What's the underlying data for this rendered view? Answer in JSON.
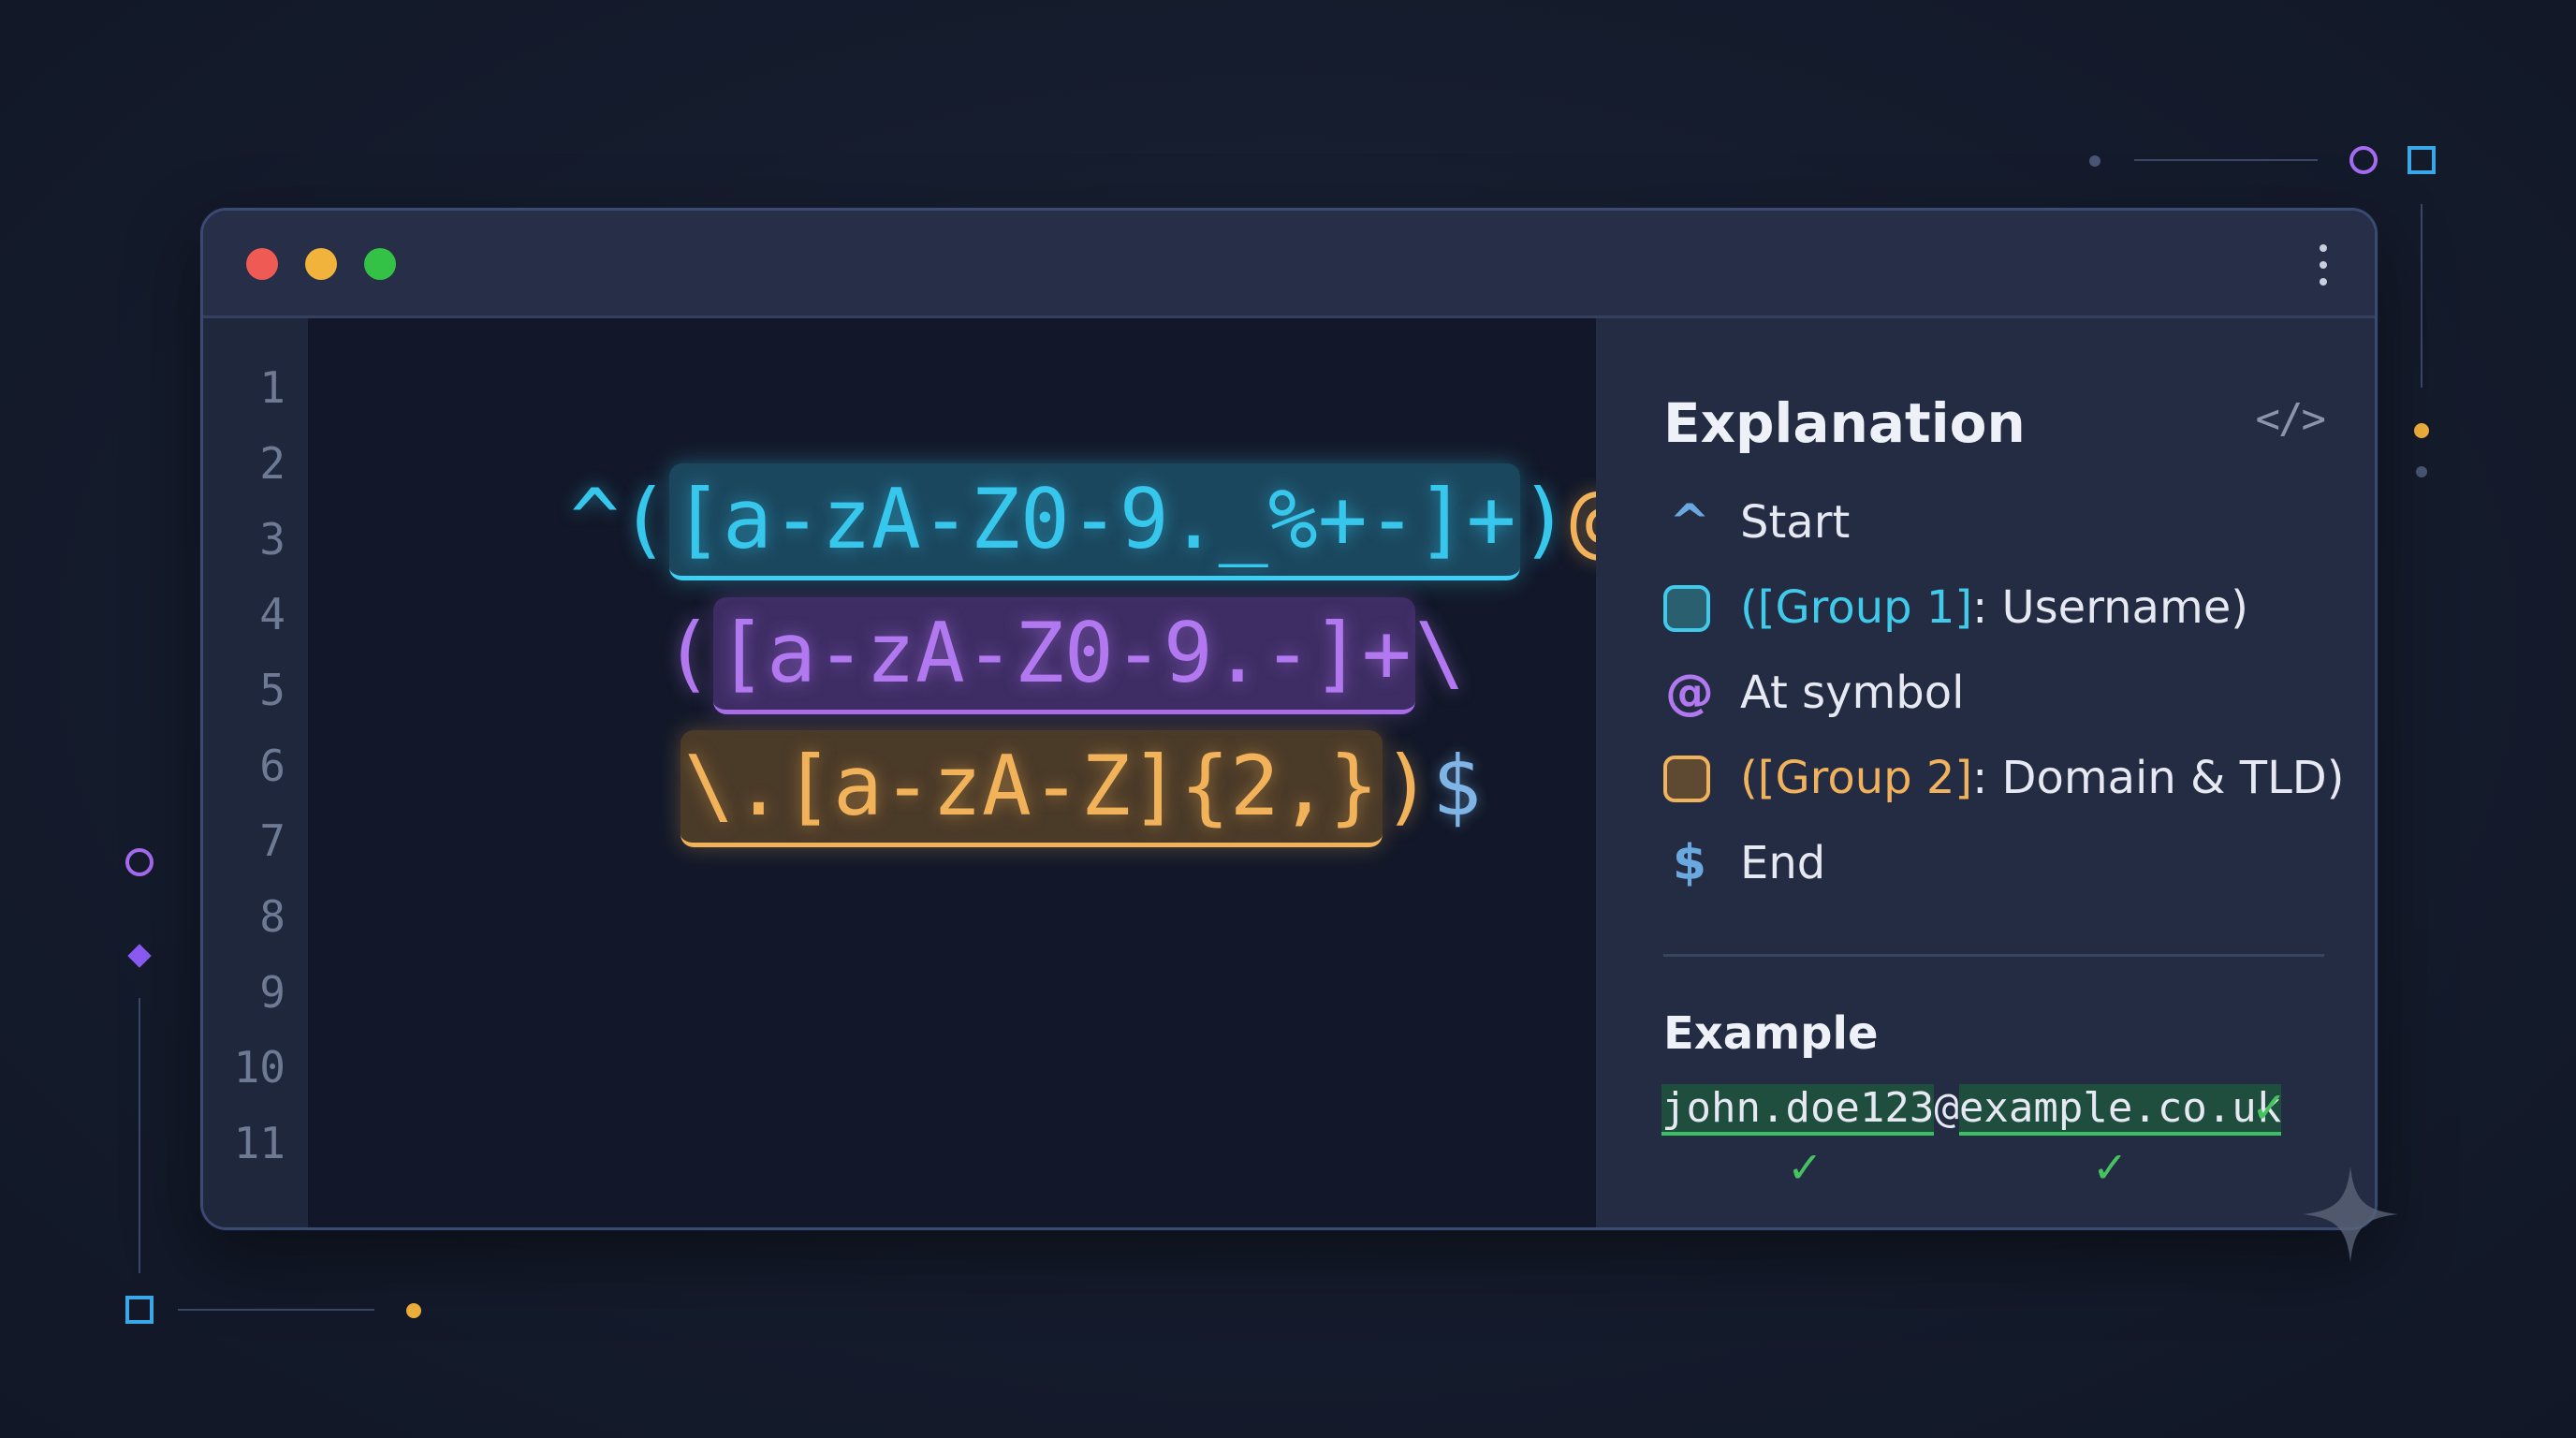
{
  "window": {
    "controls": {
      "close": "close",
      "minimize": "minimize",
      "maximize": "maximize"
    },
    "menu_icon": "more-vertical-icon"
  },
  "editor": {
    "line_numbers": [
      "1",
      "2",
      "3",
      "4",
      "5",
      "6",
      "7",
      "8",
      "9",
      "10",
      "11"
    ],
    "regex": {
      "line1": {
        "start": "^(",
        "group1": "[a-zA-Z0-9._%+-]+",
        "close": ")",
        "at": "@"
      },
      "line2": {
        "open": "(",
        "domain": "[a-zA-Z0-9.-]+",
        "escape": "\\"
      },
      "line3": {
        "tld": "\\.[a-zA-Z]{2,}",
        "close": ")",
        "end": "$"
      }
    }
  },
  "panel": {
    "title": "Explanation",
    "title_icon": "code-icon",
    "items": [
      {
        "symbol": "^",
        "text": "Start"
      },
      {
        "group": "([Group 1]",
        "text": ": Username)"
      },
      {
        "symbol": "@",
        "text": "At symbol"
      },
      {
        "group": "([Group 2]",
        "text": ": Domain & TLD)"
      },
      {
        "symbol": "$",
        "text": "End"
      }
    ],
    "example": {
      "title": "Example",
      "user": "john.doe123",
      "at": "@",
      "domain": "example.co.uk",
      "check": "✓"
    }
  },
  "colors": {
    "group1": "#41c9ea",
    "group2_domain": "#b178f0",
    "group2_tld": "#f0b25c",
    "anchor": "#6aa9e0",
    "match": "#46c35e"
  }
}
